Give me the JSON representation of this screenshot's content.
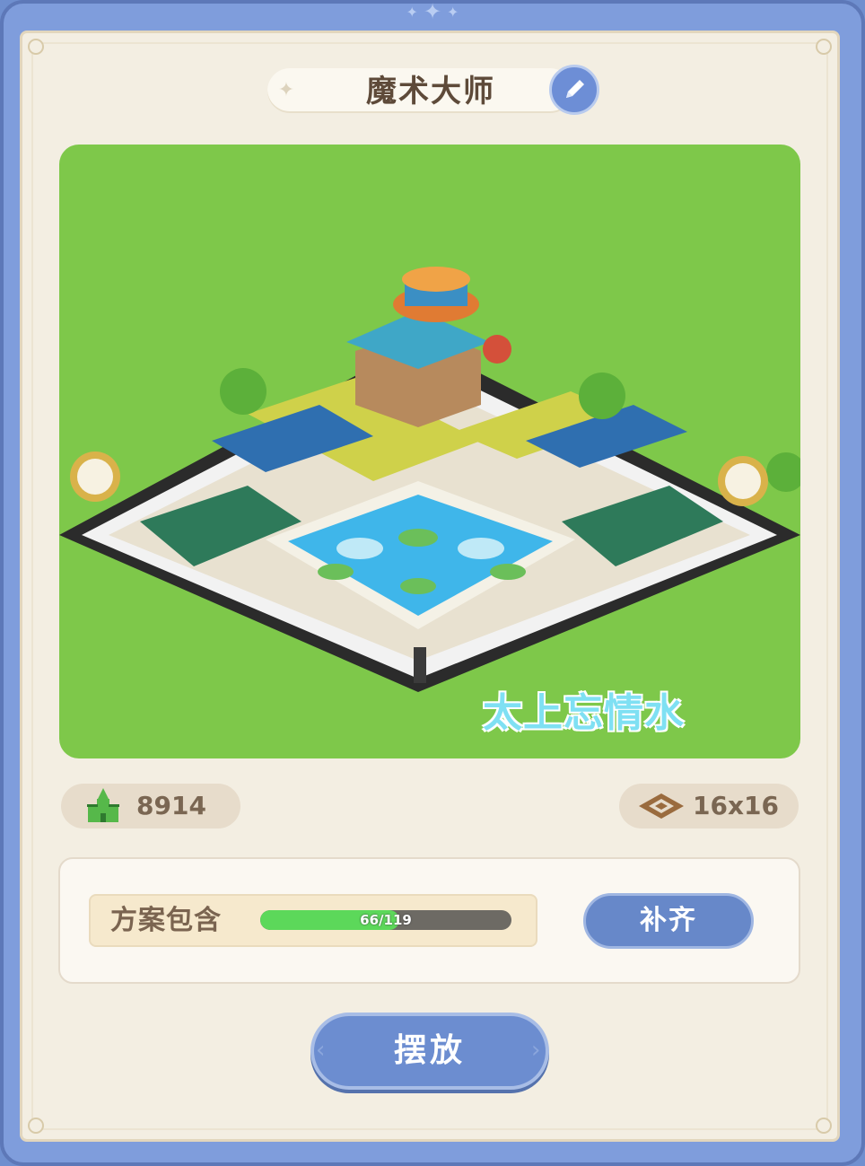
{
  "plan": {
    "title": "魔术大师",
    "watermark": "太上忘情水",
    "prosperity": "8914",
    "size": "16x16",
    "contains_label": "方案包含",
    "progress_text": "66/119",
    "progress_fraction": 0.5546,
    "fill_button": "补齐",
    "place_button": "摆放"
  },
  "icons": {
    "edit": "pencil-icon",
    "prosperity": "castle-icon",
    "size": "tiles-icon"
  },
  "colors": {
    "accent_blue": "#6c8dd0",
    "grass_green": "#7ec84a",
    "progress_green": "#5cd85a",
    "panel_cream": "#f3eee2",
    "text_brown": "#7a6652"
  }
}
